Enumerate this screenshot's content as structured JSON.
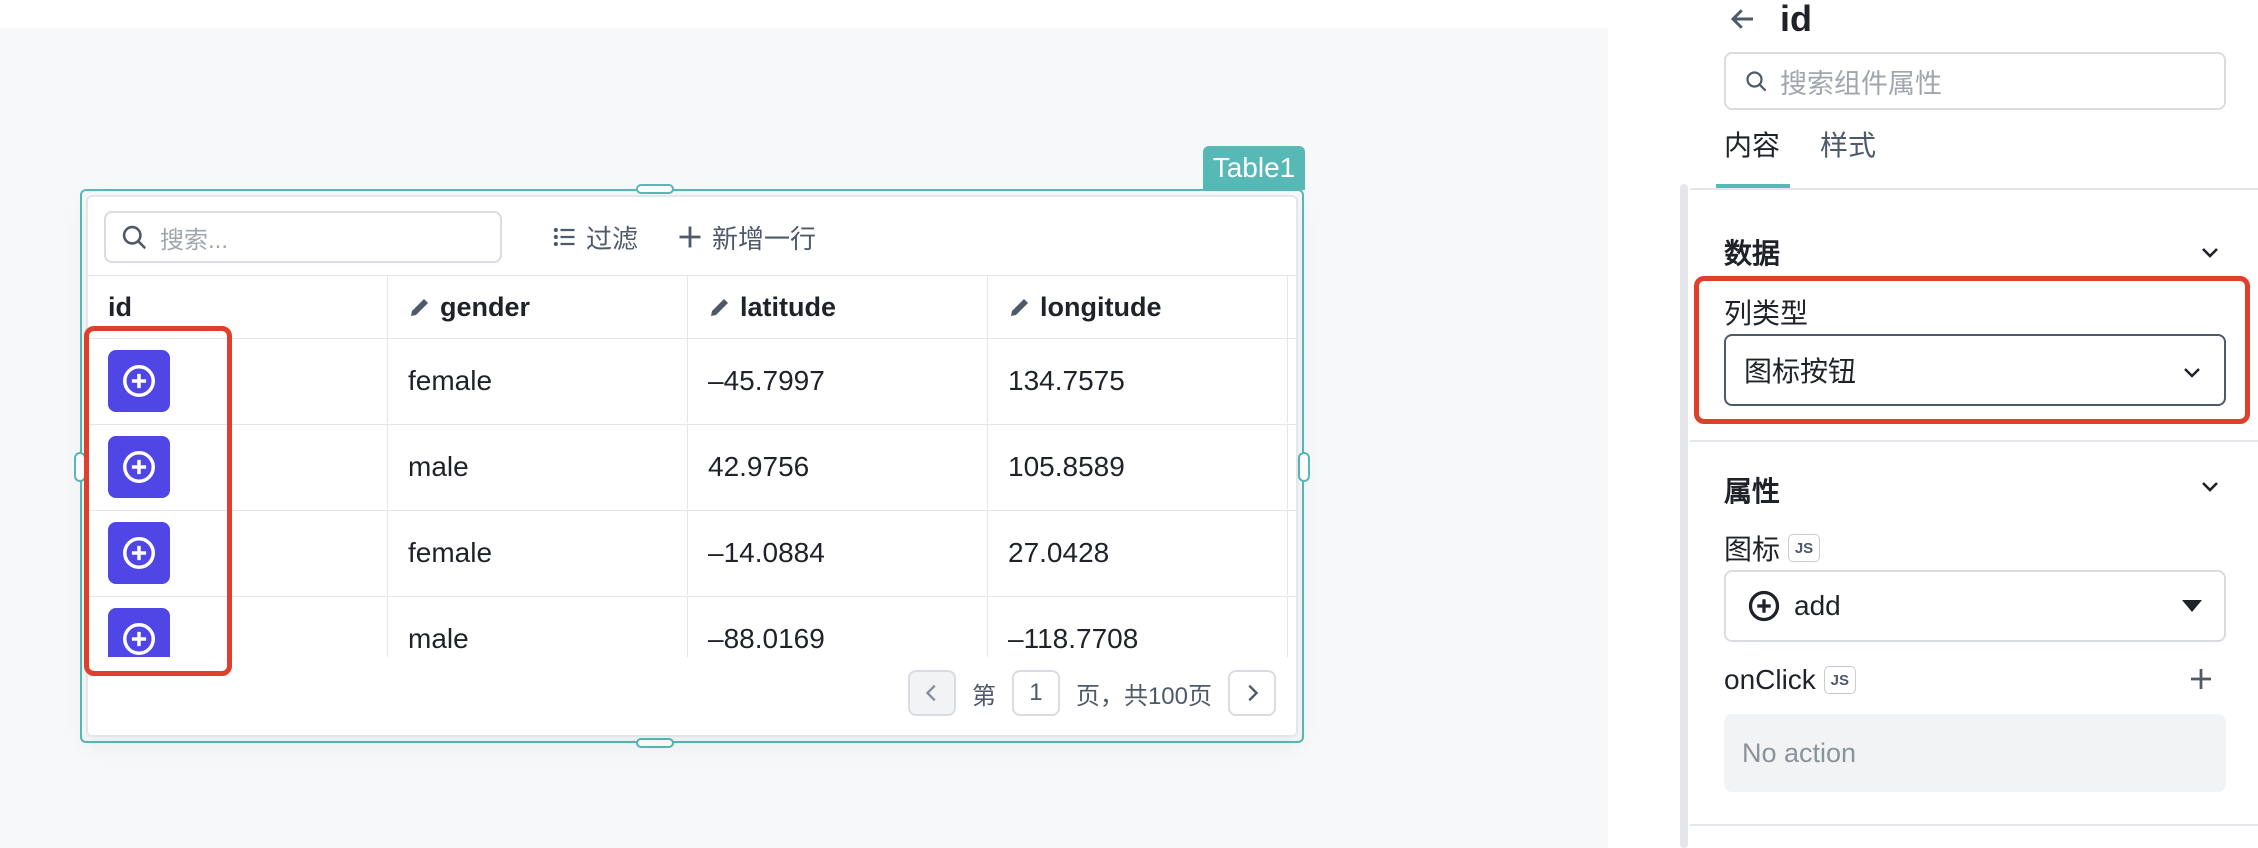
{
  "widget": {
    "name": "Table1"
  },
  "table": {
    "search_placeholder": "搜索...",
    "filter_label": "过滤",
    "add_row_label": "新增一行",
    "columns": [
      "id",
      "gender",
      "latitude",
      "longitude"
    ],
    "rows": [
      {
        "gender": "female",
        "latitude": "–45.7997",
        "longitude": "134.7575"
      },
      {
        "gender": "male",
        "latitude": "42.9756",
        "longitude": "105.8589"
      },
      {
        "gender": "female",
        "latitude": "–14.0884",
        "longitude": "27.0428"
      },
      {
        "gender": "male",
        "latitude": "–88.0169",
        "longitude": "–118.7708"
      }
    ],
    "row_button_icon": "add-circle-icon"
  },
  "pagination": {
    "prefix": "第",
    "page": "1",
    "suffix": "页，共100页"
  },
  "panel": {
    "title": "id",
    "search_placeholder": "搜索组件属性",
    "tabs": [
      "内容",
      "样式"
    ],
    "active_tab": 0,
    "data_section": {
      "title": "数据",
      "column_type_label": "列类型",
      "column_type_value": "图标按钮"
    },
    "props_section": {
      "title": "属性",
      "icon_label": "图标",
      "icon_badge": "JS",
      "icon_value": "add",
      "onclick_label": "onClick",
      "onclick_badge": "JS",
      "onclick_value": "No action"
    }
  },
  "colors": {
    "accent": "#57b9b5",
    "row_button": "#4f46e5",
    "highlight": "#e0402b"
  }
}
